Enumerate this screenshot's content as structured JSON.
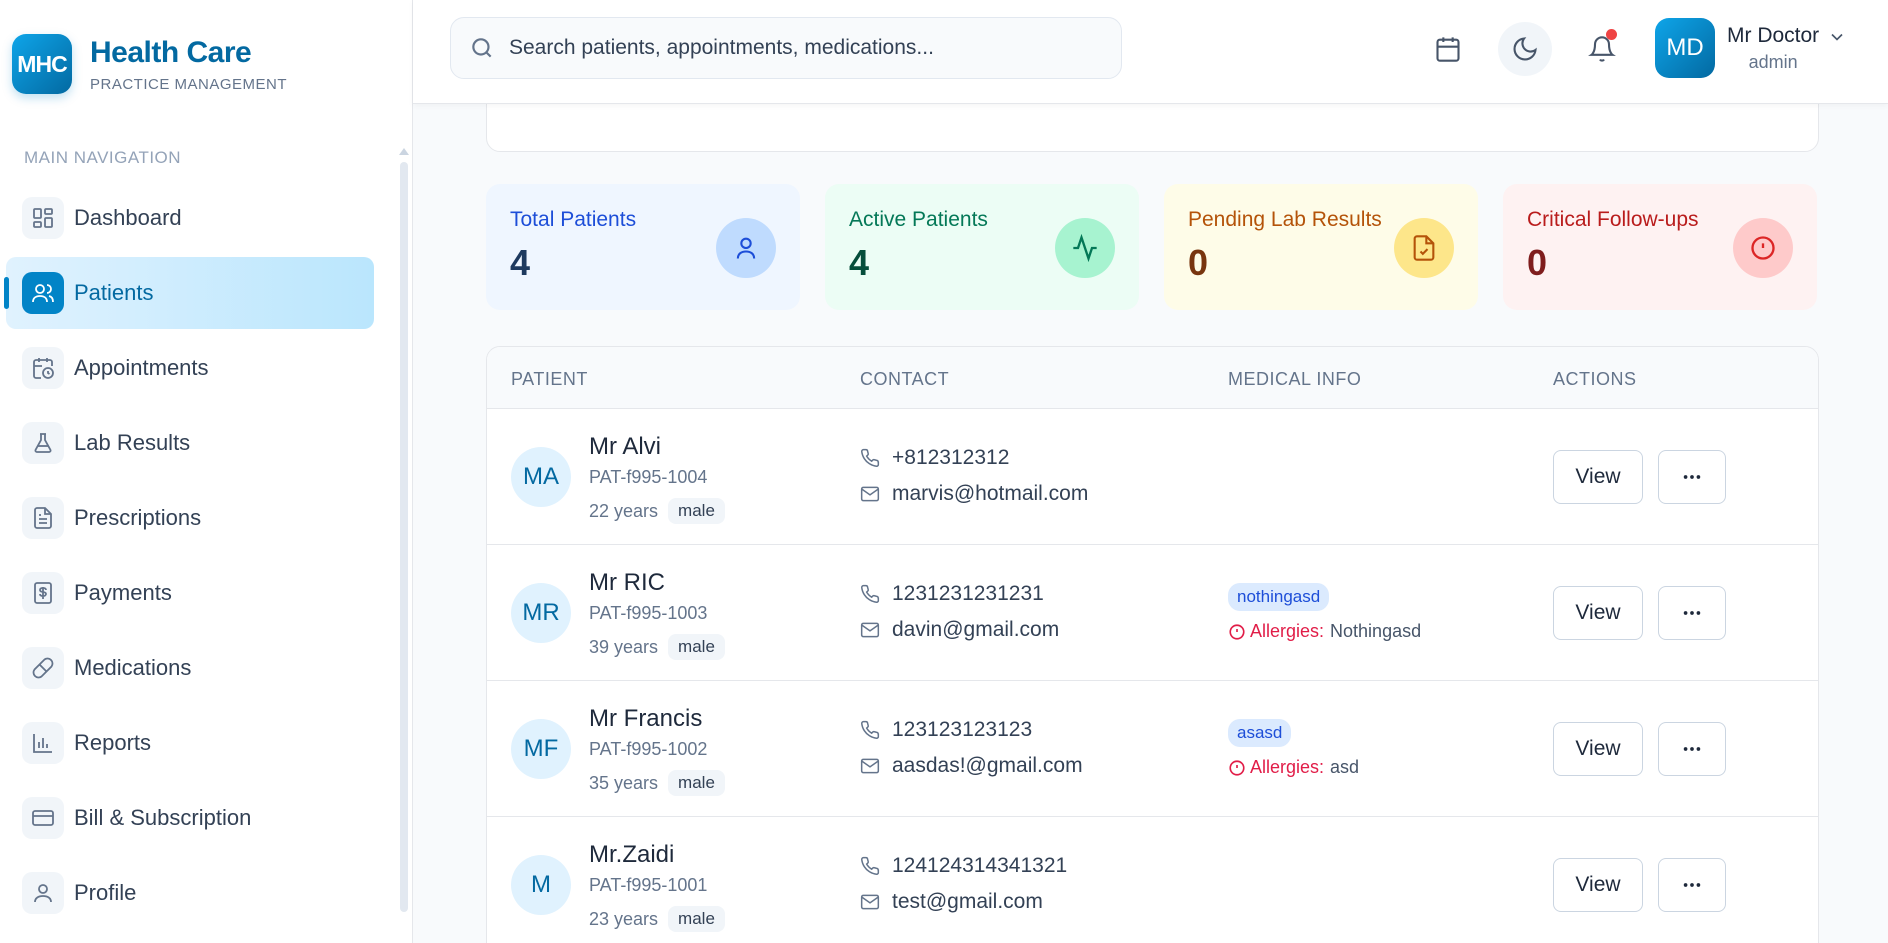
{
  "brand": {
    "logo": "MHC",
    "title": "Health Care",
    "subtitle": "PRACTICE MANAGEMENT"
  },
  "nav": {
    "heading": "MAIN NAVIGATION",
    "items": [
      {
        "label": "Dashboard",
        "icon": "dashboard-icon"
      },
      {
        "label": "Patients",
        "icon": "users-icon",
        "active": true
      },
      {
        "label": "Appointments",
        "icon": "calendar-clock-icon"
      },
      {
        "label": "Lab Results",
        "icon": "flask-icon"
      },
      {
        "label": "Prescriptions",
        "icon": "document-icon"
      },
      {
        "label": "Payments",
        "icon": "dollar-icon"
      },
      {
        "label": "Medications",
        "icon": "pill-icon"
      },
      {
        "label": "Reports",
        "icon": "bar-chart-icon"
      },
      {
        "label": "Bill & Subscription",
        "icon": "credit-card-icon"
      },
      {
        "label": "Profile",
        "icon": "user-icon"
      }
    ]
  },
  "header": {
    "search_placeholder": "Search patients, appointments, medications...",
    "user": {
      "initials": "MD",
      "name": "Mr Doctor",
      "role": "admin"
    }
  },
  "stats": [
    {
      "label": "Total Patients",
      "value": "4",
      "icon": "user-icon"
    },
    {
      "label": "Active Patients",
      "value": "4",
      "icon": "activity-icon"
    },
    {
      "label": "Pending Lab Results",
      "value": "0",
      "icon": "file-check-icon"
    },
    {
      "label": "Critical Follow-ups",
      "value": "0",
      "icon": "alert-circle-icon"
    }
  ],
  "table": {
    "columns": [
      "PATIENT",
      "CONTACT",
      "MEDICAL INFO",
      "ACTIONS"
    ],
    "view_label": "View",
    "allergies_label": "Allergies:",
    "rows": [
      {
        "initials": "MA",
        "name": "Mr Alvi",
        "id": "PAT-f995-1004",
        "age": "22 years",
        "gender": "male",
        "phone": "+812312312",
        "email": "marvis@hotmail.com"
      },
      {
        "initials": "MR",
        "name": "Mr RIC",
        "id": "PAT-f995-1003",
        "age": "39 years",
        "gender": "male",
        "phone": "1231231231231",
        "email": "davin@gmail.com",
        "tag": "nothingasd",
        "allergies": "Nothingasd"
      },
      {
        "initials": "MF",
        "name": "Mr Francis",
        "id": "PAT-f995-1002",
        "age": "35 years",
        "gender": "male",
        "phone": "123123123123",
        "email": "aasdas!@gmail.com",
        "tag": "asasd",
        "allergies": "asd"
      },
      {
        "initials": "M",
        "name": "Mr.Zaidi",
        "id": "PAT-f995-1001",
        "age": "23 years",
        "gender": "male",
        "phone": "124124314341321",
        "email": "test@gmail.com"
      }
    ]
  },
  "colors": {
    "primary": "#0284c7",
    "accent_dark": "#0369a1",
    "danger": "#e11d48"
  }
}
